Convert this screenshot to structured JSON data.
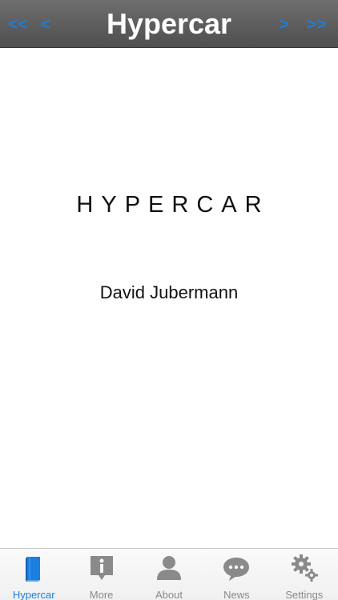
{
  "header": {
    "title": "Hypercar",
    "first_label": "<<",
    "prev_label": "<",
    "next_label": ">",
    "last_label": ">>"
  },
  "content": {
    "book_title": "HYPERCAR",
    "author": "David Jubermann"
  },
  "tabs": [
    {
      "label": "Hypercar",
      "icon": "book-icon",
      "active": true
    },
    {
      "label": "More",
      "icon": "info-icon",
      "active": false
    },
    {
      "label": "About",
      "icon": "person-icon",
      "active": false
    },
    {
      "label": "News",
      "icon": "chat-bubble-icon",
      "active": false
    },
    {
      "label": "Settings",
      "icon": "gears-icon",
      "active": false
    }
  ],
  "colors": {
    "accent": "#1a7fe0",
    "header_bg": "#5a5a5a",
    "inactive_tab": "#8a8a8a"
  }
}
